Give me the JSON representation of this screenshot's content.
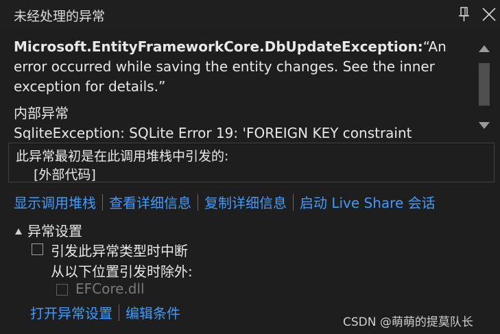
{
  "window": {
    "title": "未经处理的异常"
  },
  "icons": {
    "pin": "pin-icon",
    "close": "close-icon"
  },
  "message": {
    "exception_type": "Microsoft.EntityFrameworkCore.DbUpdateException:",
    "exception_text_line1": "“An",
    "exception_text_line2": "error occurred while saving the entity changes. See the inner",
    "exception_text_line3": "exception for details.”",
    "inner_heading": "内部异常",
    "inner_text": "SqliteException: SQLite Error 19: 'FOREIGN KEY constraint"
  },
  "callstack": {
    "heading": "此异常最初是在此调用堆栈中引发的:",
    "frame": "[外部代码]"
  },
  "actions": {
    "show_call_stack": "显示调用堆栈",
    "view_details": "查看详细信息",
    "copy_details": "复制详细信息",
    "live_share": "启动 Live Share 会话"
  },
  "exception_settings": {
    "heading": "异常设置",
    "break_label": "引发此异常类型时中断",
    "except_label": "从以下位置引发时除外:",
    "module_label": "EFCore.dll",
    "open_settings": "打开异常设置",
    "edit_conditions": "编辑条件"
  },
  "watermark": "CSDN @萌萌的提莫队长",
  "colors": {
    "background": "#1e1e1e",
    "link": "#3f9bff",
    "text": "#e8e8e8",
    "disabled": "#7a7a7a"
  }
}
